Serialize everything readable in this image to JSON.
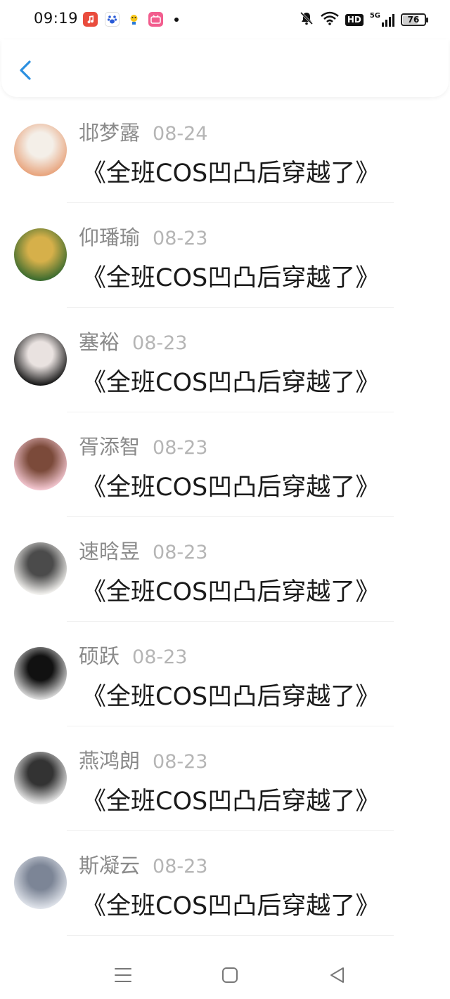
{
  "status_bar": {
    "time": "09:19",
    "battery": "76",
    "battery_level": 0.76,
    "network": "5G",
    "hd_label": "HD",
    "icons": [
      "music-app-icon",
      "baidu-app-icon",
      "tieba-app-icon",
      "video-app-icon",
      "notification-dot",
      "mute-icon",
      "wifi-icon",
      "hd-icon",
      "5g-signal-icon",
      "battery-icon"
    ]
  },
  "header": {
    "back_icon": "chevron-left-icon"
  },
  "comments": [
    {
      "name": "邶梦露",
      "date": "08-24",
      "message": "《全班COS凹凸后穿越了》",
      "avatar": "girl-portrait",
      "avatar_colors": [
        "#e8a47d",
        "#f4efe8"
      ]
    },
    {
      "name": "仰璠瑜",
      "date": "08-23",
      "message": "《全班COS凹凸后穿越了》",
      "avatar": "jungle-scene",
      "avatar_colors": [
        "#3b6b2f",
        "#d6b04a"
      ]
    },
    {
      "name": "塞裕",
      "date": "08-23",
      "message": "《全班COS凹凸后穿越了》",
      "avatar": "dark-hair-anime",
      "avatar_colors": [
        "#1a1a1a",
        "#e9e2e0"
      ]
    },
    {
      "name": "胥添智",
      "date": "08-23",
      "message": "《全班COS凹凸后穿越了》",
      "avatar": "child-photo",
      "avatar_colors": [
        "#f3c6d0",
        "#7b4a3a"
      ]
    },
    {
      "name": "速晗昱",
      "date": "08-23",
      "message": "《全班COS凹凸后穿越了》",
      "avatar": "ink-painting",
      "avatar_colors": [
        "#f2f1ee",
        "#4b4b4b"
      ]
    },
    {
      "name": "硕跃",
      "date": "08-23",
      "message": "《全班COS凹凸后穿越了》",
      "avatar": "bw-photo",
      "avatar_colors": [
        "#d9d9d9",
        "#111111"
      ]
    },
    {
      "name": "燕鸿朗",
      "date": "08-23",
      "message": "《全班COS凹凸后穿越了》",
      "avatar": "bw-sketch",
      "avatar_colors": [
        "#e6e6e6",
        "#333333"
      ]
    },
    {
      "name": "斯凝云",
      "date": "08-23",
      "message": "《全班COS凹凸后穿越了》",
      "avatar": "pale-face",
      "avatar_colors": [
        "#dfe3ea",
        "#7c8596"
      ]
    }
  ],
  "nav_bar": {
    "buttons": [
      "menu-icon",
      "home-square-icon",
      "back-triangle-icon"
    ]
  },
  "colors": {
    "accent": "#2b8fe0",
    "name": "#8a8a8a",
    "date": "#b5b5b5",
    "message": "#1a1a1a"
  }
}
